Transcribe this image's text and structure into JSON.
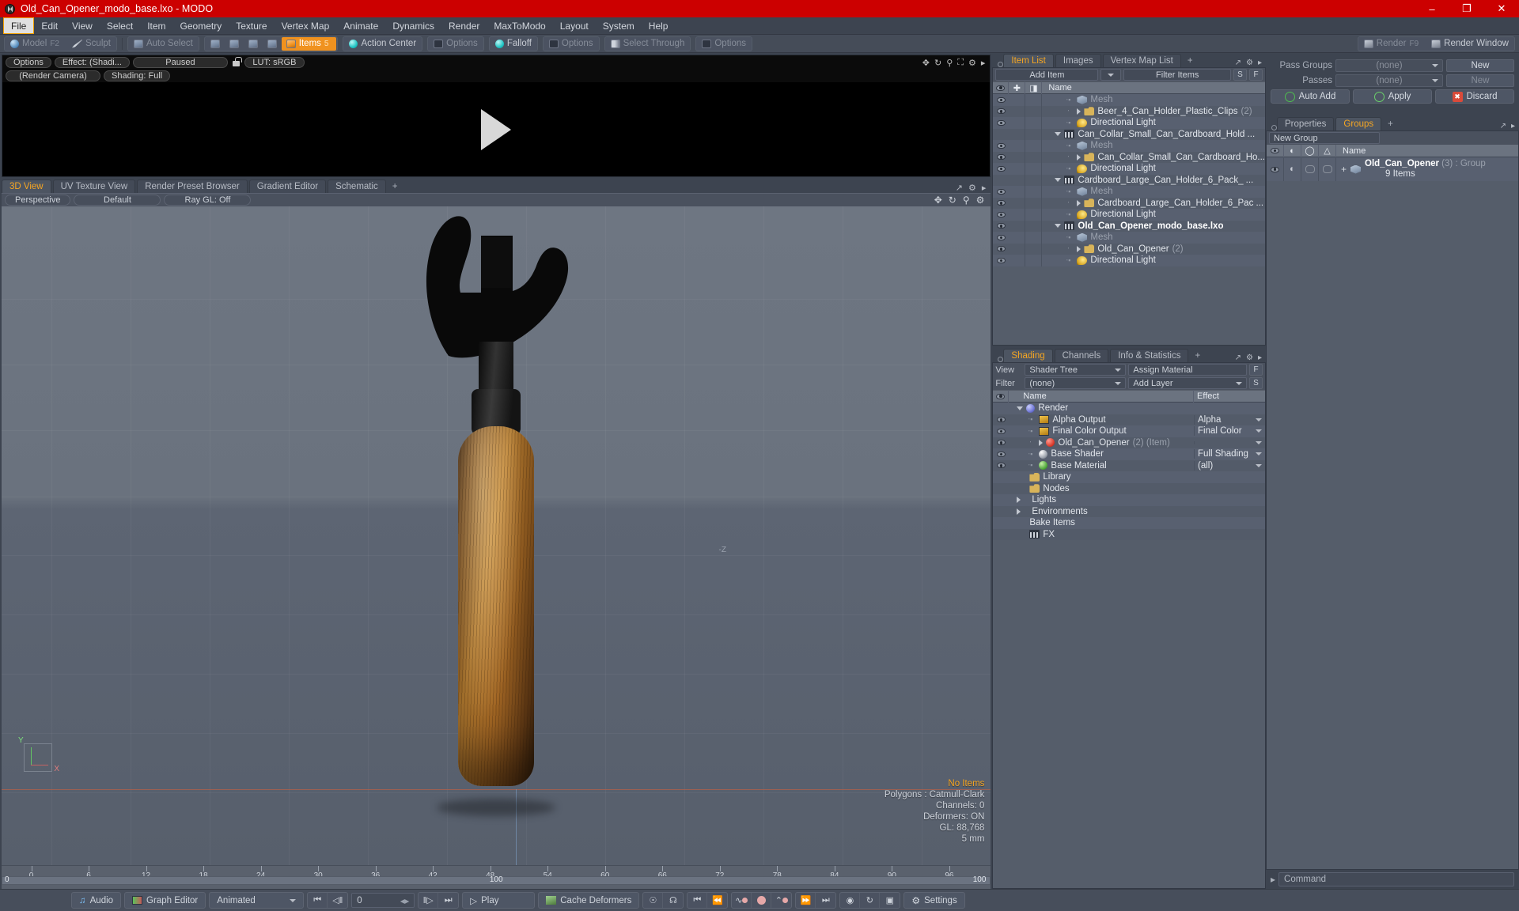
{
  "window": {
    "title": "Old_Can_Opener_modo_base.lxo - MODO",
    "minimize": "–",
    "maximize": "❐",
    "close": "✕"
  },
  "menu": {
    "items": [
      "File",
      "Edit",
      "View",
      "Select",
      "Item",
      "Geometry",
      "Texture",
      "Vertex Map",
      "Animate",
      "Dynamics",
      "Render",
      "MaxToModo",
      "Layout",
      "System",
      "Help"
    ]
  },
  "toolbar": {
    "mode_model": "Model",
    "mode_model_key": "F2",
    "mode_sculpt": "Sculpt",
    "auto_select": "Auto Select",
    "items": "Items",
    "items_key": "5",
    "action_center": "Action Center",
    "options_1": "Options",
    "falloff": "Falloff",
    "options_2": "Options",
    "select_through": "Select Through",
    "options_3": "Options",
    "render": "Render",
    "render_key": "F9",
    "render_window": "Render Window"
  },
  "preview": {
    "options": "Options",
    "effect": "Effect: (Shadi...",
    "paused": "Paused",
    "lut": "LUT: sRGB",
    "render_camera": "(Render Camera)",
    "shading": "Shading: Full"
  },
  "viewport": {
    "tabs": [
      {
        "label": "3D View",
        "active": true
      },
      {
        "label": "UV Texture View",
        "active": false
      },
      {
        "label": "Render Preset Browser",
        "active": false
      },
      {
        "label": "Gradient Editor",
        "active": false
      },
      {
        "label": "Schematic",
        "active": false
      },
      {
        "label": "+",
        "active": false
      }
    ],
    "perspective": "Perspective",
    "shading_preset": "Default",
    "ray_gl": "Ray GL: Off",
    "axis_z": "-Z",
    "axis_y": "Y",
    "axis_x": "X",
    "stats": {
      "selection": "No Items",
      "polygons": "Polygons : Catmull-Clark",
      "channels": "Channels: 0",
      "deformers": "Deformers: ON",
      "gl": "GL: 88,768",
      "scale": "5 mm"
    },
    "ruler": {
      "ticks": [
        "0",
        "6",
        "12",
        "18",
        "24",
        "30",
        "36",
        "42",
        "48",
        "54",
        "60",
        "66",
        "72",
        "78",
        "84",
        "90",
        "96"
      ],
      "left_end": "0",
      "mid": "100",
      "right_end": "100"
    }
  },
  "item_list": {
    "tabs": [
      {
        "label": "Item List",
        "active": true
      },
      {
        "label": "Images",
        "active": false
      },
      {
        "label": "Vertex Map List",
        "active": false
      },
      {
        "label": "+",
        "active": false
      }
    ],
    "add_item": "Add Item",
    "filter_placeholder": "Filter Items",
    "btn_s": "S",
    "btn_f": "F",
    "columns": [
      "Name"
    ],
    "rows": [
      {
        "indent": 2,
        "icon": "mesh",
        "label": "Mesh",
        "count": "",
        "ghost": true,
        "toggle": "dash",
        "eye": true
      },
      {
        "indent": 2,
        "icon": "folder",
        "label": "Beer_4_Can_Holder_Plastic_Clips",
        "count": "(2)",
        "ghost": false,
        "toggle": "right",
        "eye": true
      },
      {
        "indent": 2,
        "icon": "light",
        "label": "Directional Light",
        "count": "",
        "ghost": false,
        "toggle": "dash",
        "eye": true
      },
      {
        "indent": 1,
        "icon": "film",
        "label": "Can_Collar_Small_Can_Cardboard_Hold ...",
        "count": "",
        "ghost": false,
        "toggle": "down",
        "eye": false
      },
      {
        "indent": 2,
        "icon": "mesh",
        "label": "Mesh",
        "count": "",
        "ghost": true,
        "toggle": "dash",
        "eye": true
      },
      {
        "indent": 2,
        "icon": "folder",
        "label": "Can_Collar_Small_Can_Cardboard_Ho...",
        "count": "",
        "ghost": false,
        "toggle": "right",
        "eye": true
      },
      {
        "indent": 2,
        "icon": "light",
        "label": "Directional Light",
        "count": "",
        "ghost": false,
        "toggle": "dash",
        "eye": true
      },
      {
        "indent": 1,
        "icon": "film",
        "label": "Cardboard_Large_Can_Holder_6_Pack_ ...",
        "count": "",
        "ghost": false,
        "toggle": "down",
        "eye": false
      },
      {
        "indent": 2,
        "icon": "mesh",
        "label": "Mesh",
        "count": "",
        "ghost": true,
        "toggle": "dash",
        "eye": true
      },
      {
        "indent": 2,
        "icon": "folder",
        "label": "Cardboard_Large_Can_Holder_6_Pac ...",
        "count": "",
        "ghost": false,
        "toggle": "right",
        "eye": true
      },
      {
        "indent": 2,
        "icon": "light",
        "label": "Directional Light",
        "count": "",
        "ghost": false,
        "toggle": "dash",
        "eye": true
      },
      {
        "indent": 1,
        "icon": "film",
        "label": "Old_Can_Opener_modo_base.lxo",
        "count": "",
        "ghost": false,
        "bold": true,
        "toggle": "down",
        "eye": true
      },
      {
        "indent": 2,
        "icon": "mesh",
        "label": "Mesh",
        "count": "",
        "ghost": true,
        "toggle": "dash",
        "eye": true
      },
      {
        "indent": 2,
        "icon": "folder",
        "label": "Old_Can_Opener",
        "count": "(2)",
        "ghost": false,
        "toggle": "right",
        "eye": true
      },
      {
        "indent": 2,
        "icon": "light",
        "label": "Directional Light",
        "count": "",
        "ghost": false,
        "toggle": "dash",
        "eye": true
      }
    ]
  },
  "shading": {
    "tabs": [
      {
        "label": "Shading",
        "active": true
      },
      {
        "label": "Channels",
        "active": false
      },
      {
        "label": "Info & Statistics",
        "active": false
      },
      {
        "label": "+",
        "active": false
      }
    ],
    "view_label": "View",
    "view_value": "Shader Tree",
    "assign_material": "Assign Material",
    "btn_f": "F",
    "filter_label": "Filter",
    "filter_value": "(none)",
    "add_layer": "Add Layer",
    "btn_s": "S",
    "columns": {
      "name": "Name",
      "effect": "Effect"
    },
    "rows": [
      {
        "indent": 1,
        "icon": "sphereB",
        "label": "Render",
        "effect": "",
        "toggle": "down",
        "eye": false,
        "caret": false
      },
      {
        "indent": 2,
        "icon": "img",
        "label": "Alpha Output",
        "effect": "Alpha",
        "toggle": "dash",
        "eye": true,
        "caret": true
      },
      {
        "indent": 2,
        "icon": "img",
        "label": "Final Color Output",
        "effect": "Final Color",
        "toggle": "dash",
        "eye": true,
        "caret": true
      },
      {
        "indent": 2,
        "icon": "sphereR",
        "label": "Old_Can_Opener",
        "count": "(2) (Item)",
        "effect": "",
        "toggle": "right",
        "eye": true,
        "caret": true
      },
      {
        "indent": 2,
        "icon": "sphereW",
        "label": "Base Shader",
        "effect": "Full Shading",
        "toggle": "dash",
        "eye": true,
        "caret": true
      },
      {
        "indent": 2,
        "icon": "sphereG",
        "label": "Base Material",
        "effect": "(all)",
        "toggle": "dash",
        "eye": true,
        "caret": true
      },
      {
        "indent": 2,
        "icon": "folder",
        "label": "Library",
        "effect": "",
        "toggle": "none",
        "eye": false,
        "caret": false
      },
      {
        "indent": 2,
        "icon": "folder",
        "label": "Nodes",
        "effect": "",
        "toggle": "none",
        "eye": false,
        "caret": false
      },
      {
        "indent": 1,
        "icon": "none",
        "label": "Lights",
        "effect": "",
        "toggle": "right",
        "eye": false,
        "caret": false
      },
      {
        "indent": 1,
        "icon": "none",
        "label": "Environments",
        "effect": "",
        "toggle": "right",
        "eye": false,
        "caret": false
      },
      {
        "indent": 1,
        "icon": "none",
        "label": "Bake Items",
        "effect": "",
        "toggle": "none",
        "eye": false,
        "caret": false
      },
      {
        "indent": 1,
        "icon": "film",
        "label": "FX",
        "effect": "",
        "toggle": "none",
        "eye": false,
        "caret": false
      }
    ]
  },
  "passes": {
    "pass_groups_label": "Pass Groups",
    "pass_groups_value": "(none)",
    "pass_groups_new": "New",
    "passes_label": "Passes",
    "passes_value": "(none)",
    "passes_new": "New",
    "auto_add": "Auto Add",
    "apply": "Apply",
    "discard": "Discard"
  },
  "groups": {
    "tabs": [
      {
        "label": "Properties",
        "active": false
      },
      {
        "label": "Groups",
        "active": true
      },
      {
        "label": "+",
        "active": false
      }
    ],
    "new_group": "New Group",
    "columns": [
      "Name"
    ],
    "row": {
      "plus": "+",
      "name": "Old_Can_Opener",
      "count": "(3)",
      "suffix": ": Group",
      "sub": "9 Items"
    }
  },
  "command": {
    "placeholder": "Command"
  },
  "bottom": {
    "audio": "Audio",
    "graph_editor": "Graph Editor",
    "animated": "Animated",
    "frame_value": "0",
    "play": "Play",
    "cache_deformers": "Cache Deformers",
    "settings": "Settings",
    "nav": {
      "first": "⏮",
      "prev": "◁‖",
      "next": "‖▷",
      "last": "⏭"
    }
  },
  "colors": {
    "title_bar": "#cc0000",
    "accent": "#f5a623",
    "panel": "#4a515e",
    "chrome": "#3d4450",
    "list_row": "#586070"
  }
}
